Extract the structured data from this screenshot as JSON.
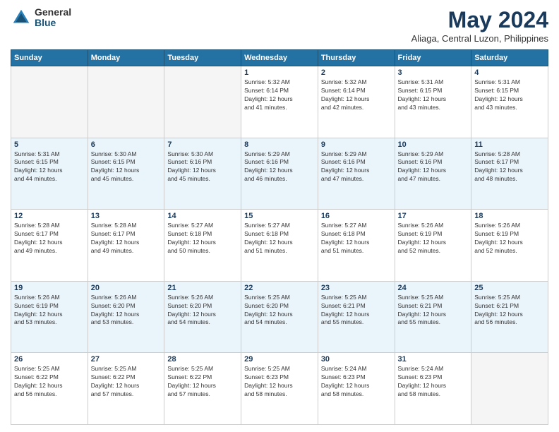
{
  "logo": {
    "general": "General",
    "blue": "Blue"
  },
  "title": "May 2024",
  "location": "Aliaga, Central Luzon, Philippines",
  "days_header": [
    "Sunday",
    "Monday",
    "Tuesday",
    "Wednesday",
    "Thursday",
    "Friday",
    "Saturday"
  ],
  "weeks": [
    [
      {
        "day": "",
        "info": ""
      },
      {
        "day": "",
        "info": ""
      },
      {
        "day": "",
        "info": ""
      },
      {
        "day": "1",
        "info": "Sunrise: 5:32 AM\nSunset: 6:14 PM\nDaylight: 12 hours\nand 41 minutes."
      },
      {
        "day": "2",
        "info": "Sunrise: 5:32 AM\nSunset: 6:14 PM\nDaylight: 12 hours\nand 42 minutes."
      },
      {
        "day": "3",
        "info": "Sunrise: 5:31 AM\nSunset: 6:15 PM\nDaylight: 12 hours\nand 43 minutes."
      },
      {
        "day": "4",
        "info": "Sunrise: 5:31 AM\nSunset: 6:15 PM\nDaylight: 12 hours\nand 43 minutes."
      }
    ],
    [
      {
        "day": "5",
        "info": "Sunrise: 5:31 AM\nSunset: 6:15 PM\nDaylight: 12 hours\nand 44 minutes."
      },
      {
        "day": "6",
        "info": "Sunrise: 5:30 AM\nSunset: 6:15 PM\nDaylight: 12 hours\nand 45 minutes."
      },
      {
        "day": "7",
        "info": "Sunrise: 5:30 AM\nSunset: 6:16 PM\nDaylight: 12 hours\nand 45 minutes."
      },
      {
        "day": "8",
        "info": "Sunrise: 5:29 AM\nSunset: 6:16 PM\nDaylight: 12 hours\nand 46 minutes."
      },
      {
        "day": "9",
        "info": "Sunrise: 5:29 AM\nSunset: 6:16 PM\nDaylight: 12 hours\nand 47 minutes."
      },
      {
        "day": "10",
        "info": "Sunrise: 5:29 AM\nSunset: 6:16 PM\nDaylight: 12 hours\nand 47 minutes."
      },
      {
        "day": "11",
        "info": "Sunrise: 5:28 AM\nSunset: 6:17 PM\nDaylight: 12 hours\nand 48 minutes."
      }
    ],
    [
      {
        "day": "12",
        "info": "Sunrise: 5:28 AM\nSunset: 6:17 PM\nDaylight: 12 hours\nand 49 minutes."
      },
      {
        "day": "13",
        "info": "Sunrise: 5:28 AM\nSunset: 6:17 PM\nDaylight: 12 hours\nand 49 minutes."
      },
      {
        "day": "14",
        "info": "Sunrise: 5:27 AM\nSunset: 6:18 PM\nDaylight: 12 hours\nand 50 minutes."
      },
      {
        "day": "15",
        "info": "Sunrise: 5:27 AM\nSunset: 6:18 PM\nDaylight: 12 hours\nand 51 minutes."
      },
      {
        "day": "16",
        "info": "Sunrise: 5:27 AM\nSunset: 6:18 PM\nDaylight: 12 hours\nand 51 minutes."
      },
      {
        "day": "17",
        "info": "Sunrise: 5:26 AM\nSunset: 6:19 PM\nDaylight: 12 hours\nand 52 minutes."
      },
      {
        "day": "18",
        "info": "Sunrise: 5:26 AM\nSunset: 6:19 PM\nDaylight: 12 hours\nand 52 minutes."
      }
    ],
    [
      {
        "day": "19",
        "info": "Sunrise: 5:26 AM\nSunset: 6:19 PM\nDaylight: 12 hours\nand 53 minutes."
      },
      {
        "day": "20",
        "info": "Sunrise: 5:26 AM\nSunset: 6:20 PM\nDaylight: 12 hours\nand 53 minutes."
      },
      {
        "day": "21",
        "info": "Sunrise: 5:26 AM\nSunset: 6:20 PM\nDaylight: 12 hours\nand 54 minutes."
      },
      {
        "day": "22",
        "info": "Sunrise: 5:25 AM\nSunset: 6:20 PM\nDaylight: 12 hours\nand 54 minutes."
      },
      {
        "day": "23",
        "info": "Sunrise: 5:25 AM\nSunset: 6:21 PM\nDaylight: 12 hours\nand 55 minutes."
      },
      {
        "day": "24",
        "info": "Sunrise: 5:25 AM\nSunset: 6:21 PM\nDaylight: 12 hours\nand 55 minutes."
      },
      {
        "day": "25",
        "info": "Sunrise: 5:25 AM\nSunset: 6:21 PM\nDaylight: 12 hours\nand 56 minutes."
      }
    ],
    [
      {
        "day": "26",
        "info": "Sunrise: 5:25 AM\nSunset: 6:22 PM\nDaylight: 12 hours\nand 56 minutes."
      },
      {
        "day": "27",
        "info": "Sunrise: 5:25 AM\nSunset: 6:22 PM\nDaylight: 12 hours\nand 57 minutes."
      },
      {
        "day": "28",
        "info": "Sunrise: 5:25 AM\nSunset: 6:22 PM\nDaylight: 12 hours\nand 57 minutes."
      },
      {
        "day": "29",
        "info": "Sunrise: 5:25 AM\nSunset: 6:23 PM\nDaylight: 12 hours\nand 58 minutes."
      },
      {
        "day": "30",
        "info": "Sunrise: 5:24 AM\nSunset: 6:23 PM\nDaylight: 12 hours\nand 58 minutes."
      },
      {
        "day": "31",
        "info": "Sunrise: 5:24 AM\nSunset: 6:23 PM\nDaylight: 12 hours\nand 58 minutes."
      },
      {
        "day": "",
        "info": ""
      }
    ]
  ]
}
